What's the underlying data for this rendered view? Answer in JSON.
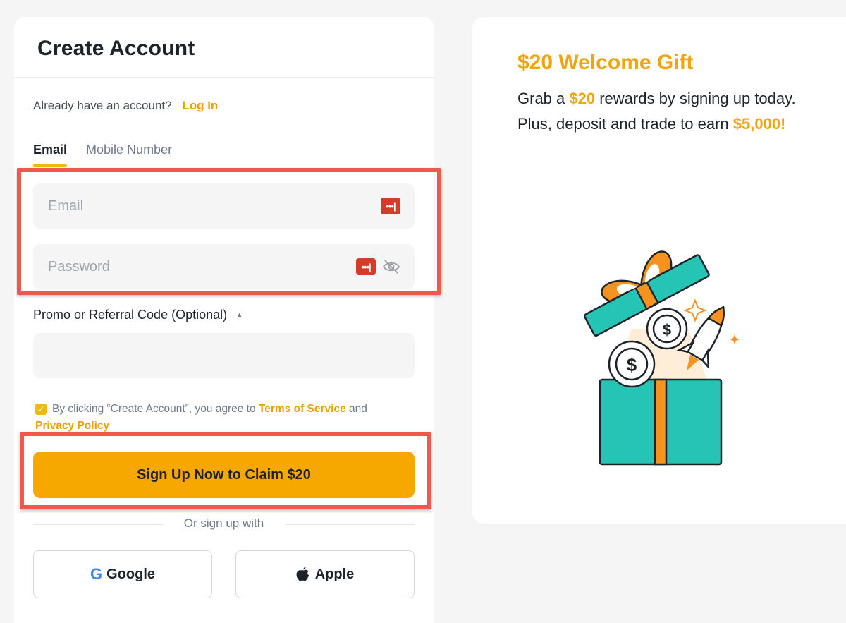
{
  "page": {
    "title": "Create Account",
    "login_prompt": "Already have an account?",
    "login_link": "Log In"
  },
  "tabs": [
    {
      "label": "Email",
      "active": true
    },
    {
      "label": "Mobile Number",
      "active": false
    }
  ],
  "fields": {
    "email_placeholder": "Email",
    "email_value": "",
    "password_placeholder": "Password",
    "password_value": "",
    "promo_label": "Promo or Referral Code (Optional)",
    "promo_value": ""
  },
  "agreement": {
    "checked": true,
    "text_before": "By clicking “Create Account”, you agree to ",
    "terms_link": "Terms of Service",
    "text_and": " and ",
    "privacy_link": "Privacy Policy"
  },
  "signup": {
    "button_label": "Sign Up Now to Claim $20",
    "or_text": "Or sign up with"
  },
  "social": {
    "google_label": "Google",
    "google_icon": "G",
    "apple_label": "Apple"
  },
  "promo_panel": {
    "title": "$20 Welcome Gift",
    "desc_part1": "Grab a ",
    "desc_amount": "$20",
    "desc_part2": " rewards by signing up today. Plus, deposit and trade to earn ",
    "desc_bonus": "$5,000!"
  },
  "colors": {
    "brand_yellow": "#f6a800",
    "accent_orange": "#f0a40e",
    "highlight_red": "#f0584e",
    "gift_teal": "#26c4b4",
    "pw_manager_red": "#d53a2b"
  },
  "icons": {
    "password_manager": "password-manager-icon",
    "eye_slash": "eye-slash-icon",
    "caret_up": "caret-up-icon",
    "checkbox": "checkbox-checked-icon",
    "google": "google-icon",
    "apple": "apple-icon",
    "gift": "gift-box-illustration"
  }
}
